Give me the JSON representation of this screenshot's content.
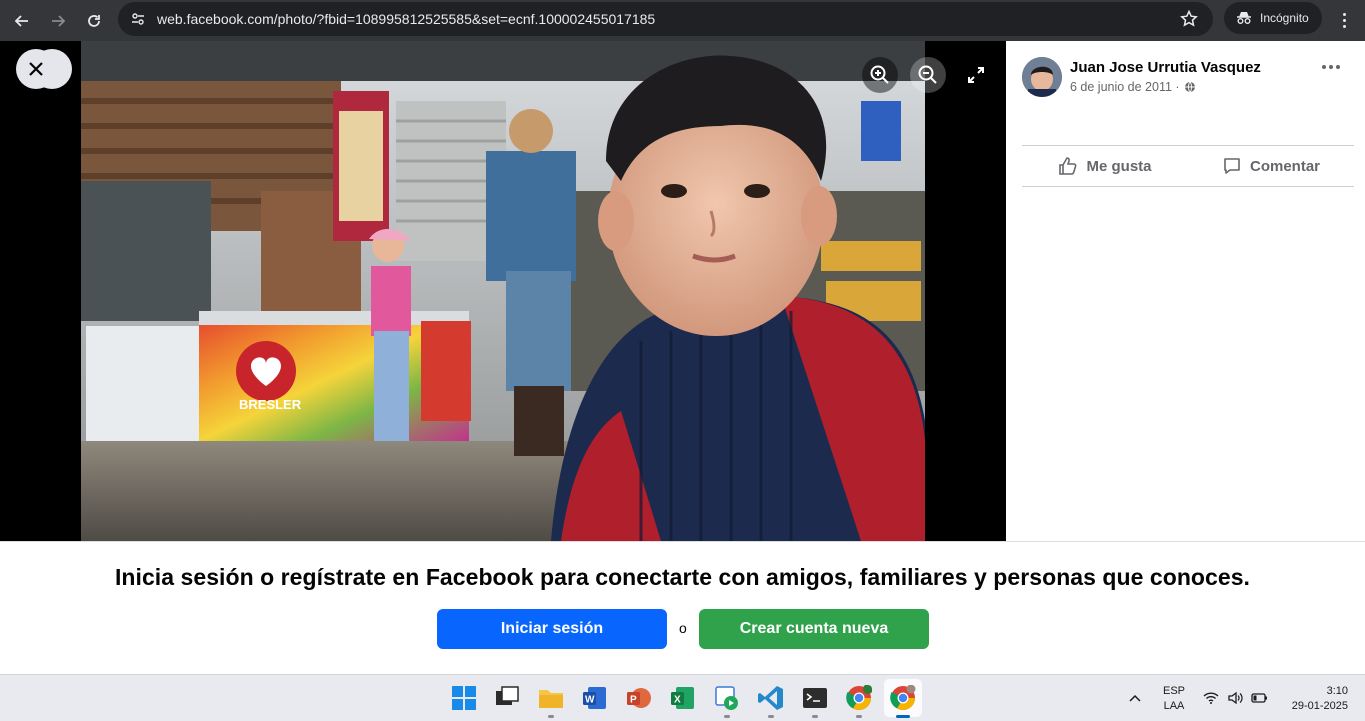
{
  "browser": {
    "url": "web.facebook.com/photo/?fbid=108995812525585&set=ecnf.100002455017185",
    "profile_label": "Incógnito"
  },
  "viewer": {
    "photo_logo_text": "BRESLER"
  },
  "post": {
    "author": "Juan Jose Urrutia Vasquez",
    "date": "6 de junio de 2011 · ",
    "like_label": "Me gusta",
    "comment_label": "Comentar"
  },
  "login_banner": {
    "title": "Inicia sesión o regístrate en Facebook para conectarte con amigos, familiares y personas que conoces.",
    "login_label": "Iniciar sesión",
    "or_label": "o",
    "signup_label": "Crear cuenta nueva"
  },
  "taskbar": {
    "lang_top": "ESP",
    "lang_bottom": "LAA",
    "time": "3:10",
    "date": "29-01-2025",
    "apps": [
      "start",
      "task-view",
      "file-explorer",
      "word",
      "powerpoint",
      "excel",
      "media-player",
      "vscode",
      "terminal",
      "chrome-profile",
      "chrome"
    ]
  }
}
